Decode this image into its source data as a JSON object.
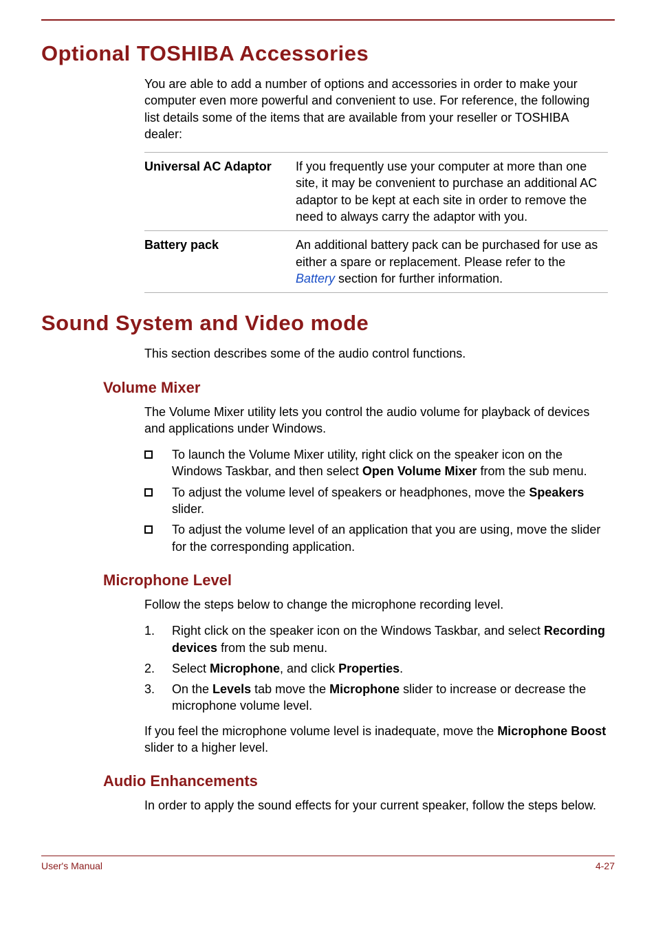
{
  "section1": {
    "title": "Optional TOSHIBA Accessories",
    "intro": "You are able to add a number of options and accessories in order to make your computer even more powerful and convenient to use. For reference, the following list details some of the items that are available from your reseller or TOSHIBA dealer:",
    "table": {
      "row1_term": "Universal AC Adaptor",
      "row1_desc": "If you frequently use your computer at more than one site, it may be convenient to purchase an additional AC adaptor to be kept at each site in order to remove the need to always carry the adaptor with you.",
      "row2_term": "Battery pack",
      "row2_desc_pre": "An additional battery pack can be purchased for use as either a spare or replacement. Please refer to the ",
      "row2_link": "Battery",
      "row2_desc_post": " section for further information."
    }
  },
  "section2": {
    "title": "Sound System and Video mode",
    "intro": "This section describes some of the audio control functions.",
    "sub1": {
      "title": "Volume Mixer",
      "para": "The Volume Mixer utility lets you control the audio volume for playback of devices and applications under Windows.",
      "b1_a": "To launch the Volume Mixer utility, right click on the speaker icon on the Windows Taskbar, and then select ",
      "b1_bold": "Open Volume Mixer",
      "b1_b": " from the sub menu.",
      "b2_a": "To adjust the volume level of speakers or headphones, move the ",
      "b2_bold": "Speakers",
      "b2_b": " slider.",
      "b3": "To adjust the volume level of an application that you are using, move the slider for the corresponding application."
    },
    "sub2": {
      "title": "Microphone Level",
      "para": "Follow the steps below to change the microphone recording level.",
      "s1_num": "1.",
      "s1_a": "Right click on the speaker icon on the Windows Taskbar, and select ",
      "s1_bold": "Recording devices",
      "s1_b": " from the sub menu.",
      "s2_num": "2.",
      "s2_a": "Select ",
      "s2_bold1": "Microphone",
      "s2_b": ", and click ",
      "s2_bold2": "Properties",
      "s2_c": ".",
      "s3_num": "3.",
      "s3_a": "On the ",
      "s3_bold1": "Levels",
      "s3_b": " tab move the ",
      "s3_bold2": "Microphone",
      "s3_c": " slider to increase or decrease the microphone volume level.",
      "close_a": "If you feel the microphone volume level is inadequate, move the ",
      "close_bold": "Microphone Boost",
      "close_b": " slider to a higher level."
    },
    "sub3": {
      "title": "Audio Enhancements",
      "para": "In order to apply the sound effects for your current speaker, follow the steps below."
    }
  },
  "footer": {
    "left": "User's Manual",
    "right": "4-27"
  }
}
